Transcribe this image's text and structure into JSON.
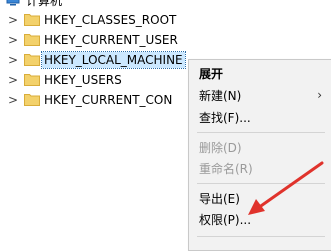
{
  "tree": {
    "root_label": "计算机",
    "items": [
      {
        "label": "HKEY_CLASSES_ROOT"
      },
      {
        "label": "HKEY_CURRENT_USER"
      },
      {
        "label": "HKEY_LOCAL_MACHINE"
      },
      {
        "label": "HKEY_USERS"
      },
      {
        "label": "HKEY_CURRENT_CON"
      }
    ]
  },
  "context_menu": {
    "items": [
      {
        "label": "展开"
      },
      {
        "label": "新建(N)"
      },
      {
        "label": "查找(F)..."
      },
      {
        "label": "删除(D)"
      },
      {
        "label": "重命名(R)"
      },
      {
        "label": "导出(E)"
      },
      {
        "label": "权限(P)..."
      }
    ]
  },
  "colors": {
    "selection_bg": "#cce8ff",
    "menu_bg": "#f2f2f2",
    "folder": "#e9c25a",
    "annotation_arrow": "#e0332c"
  }
}
